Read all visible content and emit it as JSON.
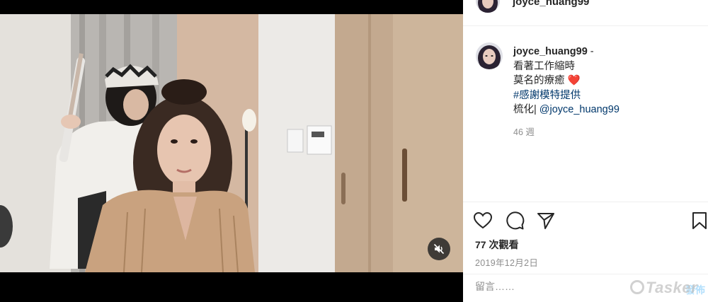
{
  "video": {
    "mute_icon": "speaker-muted-icon"
  },
  "header": {
    "username": "joyce_huang99"
  },
  "caption": {
    "username": "joyce_huang99",
    "dash": "-",
    "line1": "看著工作縮時",
    "line2": "莫名的療癒",
    "heart": "❤️",
    "hashtag": "#感謝模特提供",
    "credit_prefix": "梳化| ",
    "mention": "@joyce_huang99",
    "time_ago": "46 週"
  },
  "actions": {
    "like_icon": "heart-outline-icon",
    "comment_icon": "comment-bubble-icon",
    "share_icon": "paper-plane-icon",
    "save_icon": "bookmark-icon"
  },
  "stats": {
    "views": "77 次觀看",
    "date": "2019年12月2日"
  },
  "comment": {
    "placeholder": "留言……",
    "post_label": "發佈"
  },
  "watermark": {
    "text": "Tasker"
  },
  "colors": {
    "link": "#00376b",
    "muted_text": "#8e8e8e",
    "post_button_disabled": "#b2dffc"
  }
}
